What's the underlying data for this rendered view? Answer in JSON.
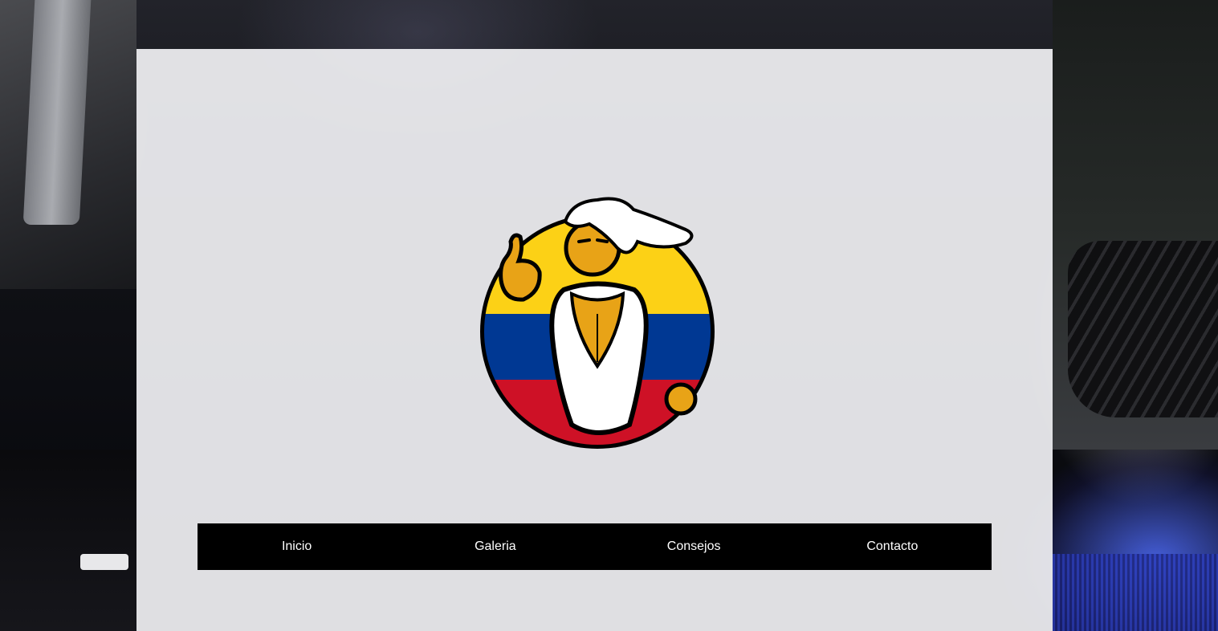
{
  "nav": {
    "items": [
      {
        "label": "Inicio"
      },
      {
        "label": "Galeria"
      },
      {
        "label": "Consejos"
      },
      {
        "label": "Contacto"
      }
    ]
  },
  "logo": {
    "icon": "colombia-mascot-logo",
    "flag_colors": [
      "#fcd116",
      "#003893",
      "#ce1126"
    ],
    "skin_color": "#e8a317"
  },
  "colors": {
    "nav_background": "#000000",
    "nav_text": "#ffffff",
    "panel_background": "#f0f0f3"
  }
}
